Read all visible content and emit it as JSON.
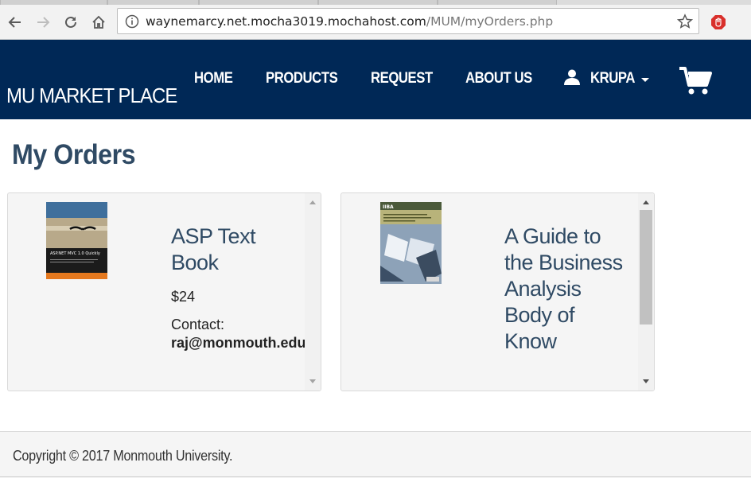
{
  "browser": {
    "url_host": "waynemarcy.net.mocha3019.mochahost.com",
    "url_path": "/MUM/myOrders.php"
  },
  "header": {
    "brand": "MU MARKET PLACE",
    "nav": [
      {
        "label": "HOME"
      },
      {
        "label": "PRODUCTS"
      },
      {
        "label": "REQUEST"
      },
      {
        "label": "ABOUT US"
      }
    ],
    "user_name": "KRUPA",
    "colors": {
      "nav_bg": "#002856",
      "title": "#2f4a64"
    }
  },
  "main": {
    "title": "My Orders",
    "orders": [
      {
        "title": "ASP Text Book",
        "price": "$24",
        "contact_label": "Contact:",
        "contact_email": "raj@monmouth.edu",
        "cover_text": "ASP.NET MVC 1.0 Quickly"
      },
      {
        "title": "A Guide to the Business Analysis Body of Know",
        "cover_text": "IIBA"
      }
    ]
  },
  "footer": {
    "copyright": "Copyright © 2017 Monmouth University."
  }
}
